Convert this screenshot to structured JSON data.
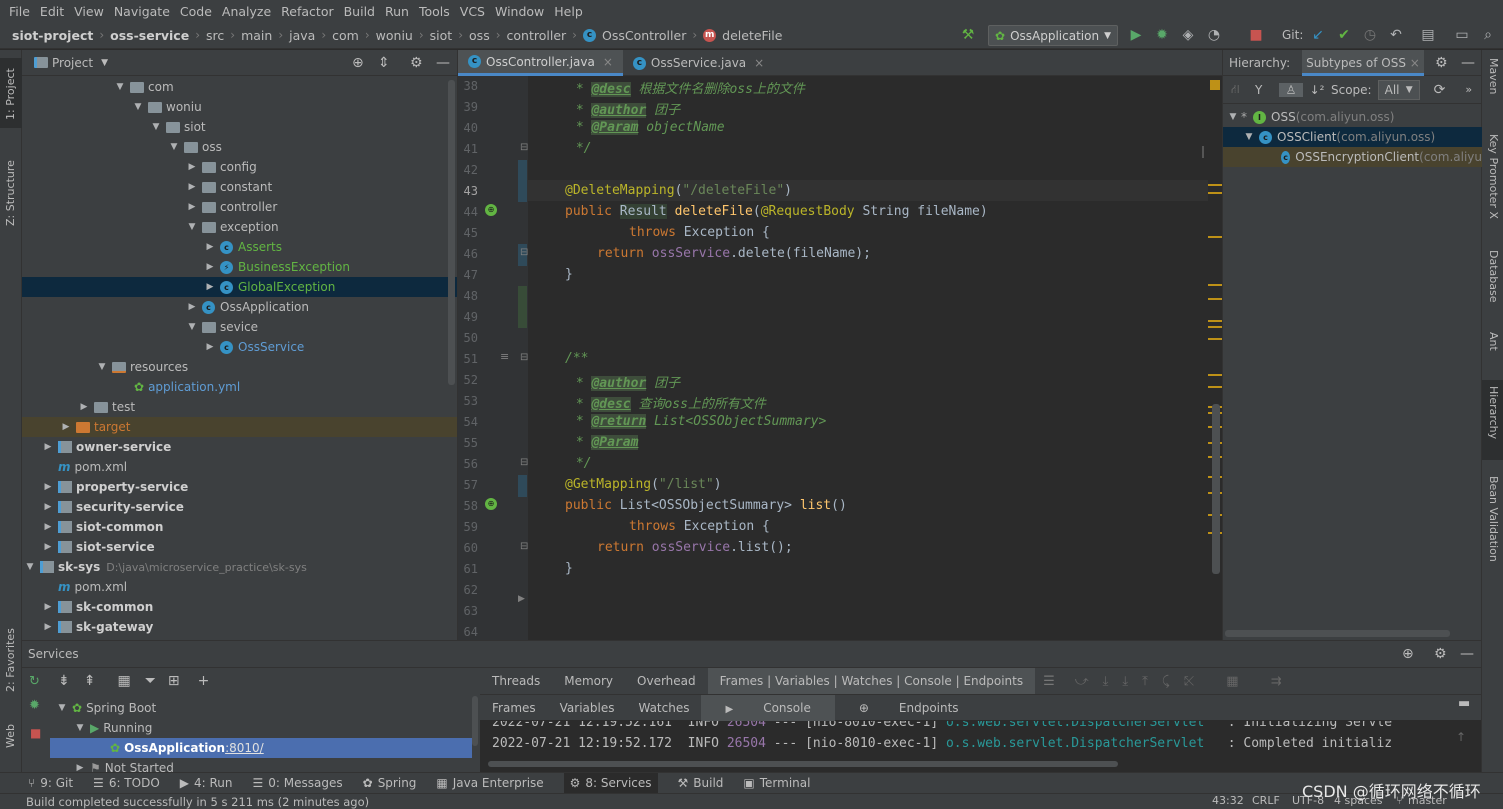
{
  "menu": [
    "File",
    "Edit",
    "View",
    "Navigate",
    "Code",
    "Analyze",
    "Refactor",
    "Build",
    "Run",
    "Tools",
    "VCS",
    "Window",
    "Help"
  ],
  "breadcrumb": [
    "siot-project",
    "oss-service",
    "src",
    "main",
    "java",
    "com",
    "woniu",
    "siot",
    "oss",
    "controller",
    "OssController",
    "deleteFile"
  ],
  "run_config": "OssApplication",
  "git_label": "Git:",
  "left_strip": {
    "project": "1: Project",
    "structure": "Z: Structure",
    "favorites": "2: Favorites",
    "web": "Web"
  },
  "right_strip": {
    "maven": "Maven",
    "key_promoter": "Key Promoter X",
    "database": "Database",
    "ant": "Ant",
    "hierarchy": "Hierarchy",
    "bean_validation": "Bean Validation"
  },
  "project": {
    "title": "Project",
    "rows": [
      {
        "label": "com",
        "extra": ""
      },
      {
        "label": "woniu",
        "extra": ""
      },
      {
        "label": "siot",
        "extra": ""
      },
      {
        "label": "oss",
        "extra": ""
      },
      {
        "label": "config",
        "extra": ""
      },
      {
        "label": "constant",
        "extra": ""
      },
      {
        "label": "controller",
        "extra": ""
      },
      {
        "label": "exception",
        "extra": ""
      },
      {
        "label": "Asserts",
        "extra": ""
      },
      {
        "label": "BusinessException",
        "extra": ""
      },
      {
        "label": "GlobalException",
        "extra": ""
      },
      {
        "label": "OssApplication",
        "extra": ""
      },
      {
        "label": "sevice",
        "extra": ""
      },
      {
        "label": "OssService",
        "extra": ""
      },
      {
        "label": "resources",
        "extra": ""
      },
      {
        "label": "application.yml",
        "extra": ""
      },
      {
        "label": "test",
        "extra": ""
      },
      {
        "label": "target",
        "extra": ""
      },
      {
        "label": "owner-service",
        "extra": ""
      },
      {
        "label": "pom.xml",
        "extra": ""
      },
      {
        "label": "property-service",
        "extra": ""
      },
      {
        "label": "security-service",
        "extra": ""
      },
      {
        "label": "siot-common",
        "extra": ""
      },
      {
        "label": "siot-service",
        "extra": ""
      },
      {
        "label": "sk-sys",
        "extra": "D:\\java\\microservice_practice\\sk-sys"
      },
      {
        "label": "pom.xml",
        "extra": ""
      },
      {
        "label": "sk-common",
        "extra": ""
      },
      {
        "label": "sk-gateway",
        "extra": ""
      }
    ]
  },
  "tabs": [
    {
      "label": "OssController.java",
      "active": true
    },
    {
      "label": "OssService.java",
      "active": false
    }
  ],
  "code": {
    "line_numbers": [
      "38",
      "39",
      "40",
      "41",
      "42",
      "43",
      "44",
      "45",
      "46",
      "47",
      "48",
      "49",
      "50",
      "51",
      "52",
      "53",
      "54",
      "55",
      "56",
      "57",
      "58",
      "59",
      "60",
      "61",
      "62",
      "63",
      "64"
    ],
    "l38_tag": "@desc",
    "l38_text": " 根据文件名删除oss上的文件",
    "l39_tag": "@author",
    "l39_text": " 团子",
    "l40_tag": "@Param",
    "l40_text": " objectName",
    "l41": " */",
    "l43_ann": "@DeleteMapping",
    "l43_str": "\"/deleteFile\"",
    "l44_kw": "public",
    "l44_type": "Result",
    "l44_fn": "deleteFile",
    "l44_ann": "@RequestBody",
    "l44_rest": " String fileName)",
    "l45_kw": "throws",
    "l45_rest": " Exception {",
    "l46_kw": "return",
    "l46_fld": "ossService",
    "l46_rest": ".delete(fileName);",
    "l47": "}",
    "l51": "/**",
    "l52_tag": "@author",
    "l52_text": " 团子",
    "l53_tag": "@desc",
    "l53_text": " 查询oss上的所有文件",
    "l54_tag": "@return",
    "l54_text": " List<OSSObjectSummary>",
    "l55_tag": "@Param",
    "l56": " */",
    "l57_ann": "@GetMapping",
    "l57_str": "\"/list\"",
    "l58_kw": "public",
    "l58_type": " List<OSSObjectSummary> ",
    "l58_fn": "list",
    "l58_rest": "()",
    "l59_kw": "throws",
    "l59_rest": " Exception {",
    "l60_kw": "return",
    "l60_fld": "ossService",
    "l60_rest": ".list();",
    "l61": "}"
  },
  "hierarchy": {
    "title": "Hierarchy:",
    "tab": "Subtypes of OSS",
    "scope_label": "Scope:",
    "scope_value": "All",
    "rows": [
      {
        "name": "OSS",
        "pkg": " (com.aliyun.oss)"
      },
      {
        "name": "OSSClient",
        "pkg": " (com.aliyun.oss)"
      },
      {
        "name": "OSSEncryptionClient",
        "pkg": " (com.aliyu"
      }
    ]
  },
  "services": {
    "title": "Services",
    "tree": [
      {
        "label": "Spring Boot"
      },
      {
        "label": "Running"
      },
      {
        "label": "OssApplication",
        "port": " :8010/"
      },
      {
        "label": "Not Started"
      }
    ],
    "debug_tabs": [
      "Threads",
      "Memory",
      "Overhead",
      "Frames | Variables | Watches | Console | Endpoints"
    ],
    "sub_tabs": [
      "Frames",
      "Variables",
      "Watches",
      "Console",
      "Endpoints"
    ],
    "console": [
      {
        "time": "2022-07-21 12:19:52.161",
        "level": "INFO",
        "pid": "26504",
        "sep": "---",
        "thread": "[nio-8010-exec-1]",
        "logger": "o.s.web.servlet.DispatcherServlet",
        "msg": "   : Initializing Servle"
      },
      {
        "time": "2022-07-21 12:19:52.172",
        "level": "INFO",
        "pid": "26504",
        "sep": "---",
        "thread": "[nio-8010-exec-1]",
        "logger": "o.s.web.servlet.DispatcherServlet",
        "msg": "   : Completed initializ"
      }
    ]
  },
  "bottom_tabs": [
    "9: Git",
    "6: TODO",
    "4: Run",
    "0: Messages",
    "Spring",
    "Java Enterprise",
    "8: Services",
    "Build",
    "Terminal"
  ],
  "status": {
    "message": "Build completed successfully in 5 s 211 ms (2 minutes ago)",
    "position": "43:32",
    "line_sep": "CRLF",
    "encoding": "UTF-8",
    "indent": "4 spaces",
    "branch": "master",
    "watermark": "CSDN @循环网络不循环"
  }
}
